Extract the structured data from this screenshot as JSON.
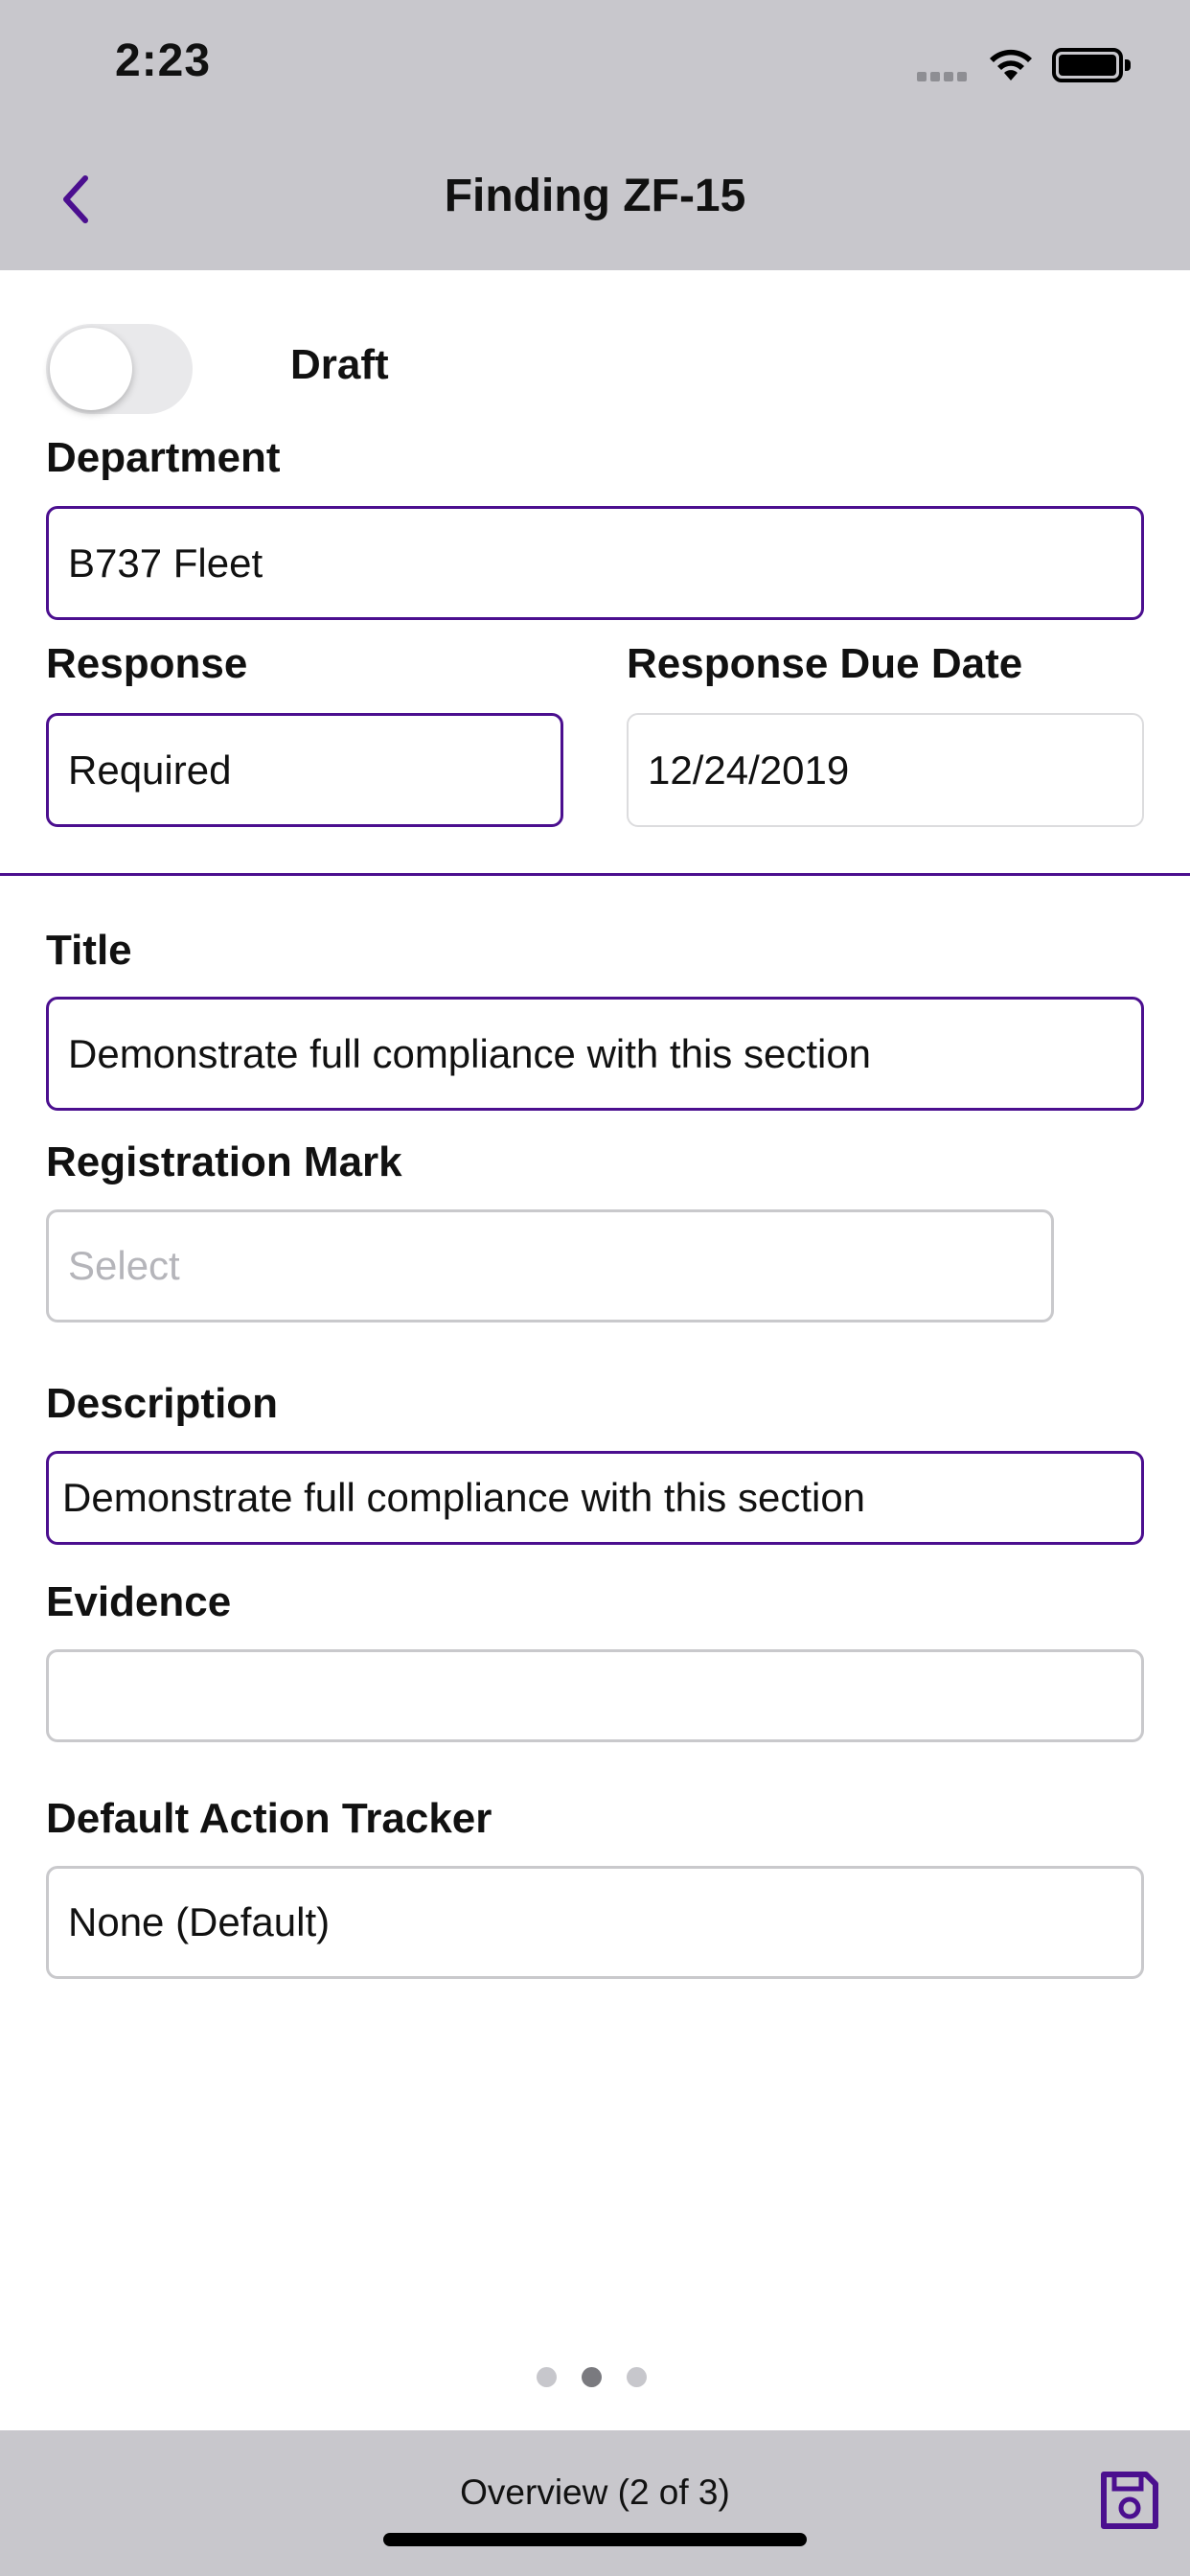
{
  "status": {
    "time": "2:23"
  },
  "nav": {
    "title": "Finding ZF-15",
    "back_icon": "chevron-left-icon"
  },
  "draft": {
    "label": "Draft",
    "on": false
  },
  "department": {
    "label": "Department",
    "value": "B737 Fleet"
  },
  "response": {
    "label": "Response",
    "value": "Required"
  },
  "due_date": {
    "label": "Response Due Date",
    "value": "12/24/2019"
  },
  "title_field": {
    "label": "Title",
    "value": "Demonstrate full compliance with this section"
  },
  "registration": {
    "label": "Registration Mark",
    "placeholder": "Select"
  },
  "description": {
    "label": "Description",
    "value": "Demonstrate full compliance with this section"
  },
  "evidence": {
    "label": "Evidence",
    "value": ""
  },
  "tracker": {
    "label": "Default Action Tracker",
    "value": "None (Default)"
  },
  "pager": {
    "count": 3,
    "current": 2
  },
  "toolbar": {
    "label": "Overview (2 of 3)",
    "save_icon": "floppy-disk-icon"
  },
  "colors": {
    "accent": "#4b0f8f",
    "bar_bg": "#c8c7cc"
  }
}
